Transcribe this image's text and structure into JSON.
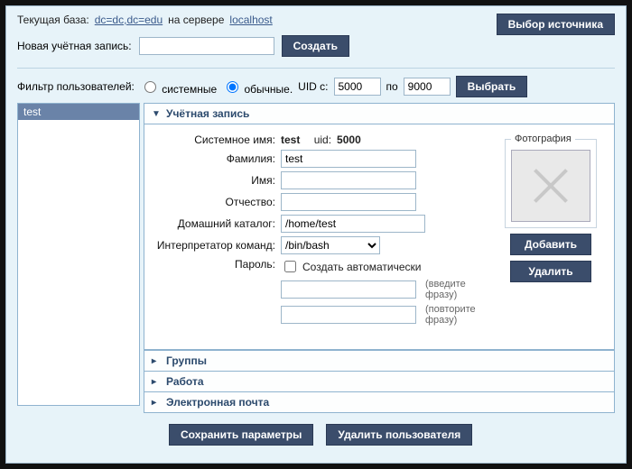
{
  "header": {
    "current_base_label": "Текущая база:",
    "base_value": "dc=dc,dc=edu",
    "on_server_label": "на сервере",
    "server_value": "localhost",
    "source_button": "Выбор источника"
  },
  "new_account": {
    "label": "Новая учётная запись:",
    "value": "",
    "create_button": "Создать"
  },
  "filters": {
    "label": "Фильтр пользователей:",
    "system_label": "системные",
    "regular_label": "обычные.",
    "uid_from_label": "UID с:",
    "uid_from": "5000",
    "uid_to_label": "по",
    "uid_to": "9000",
    "select_button": "Выбрать"
  },
  "user_list": {
    "items": [
      "test"
    ]
  },
  "sections": {
    "account": {
      "title": "Учётная запись",
      "sysname_label": "Системное имя:",
      "sysname_value": "test",
      "uid_label": "uid:",
      "uid_value": "5000",
      "lastname_label": "Фамилия:",
      "lastname_value": "test",
      "firstname_label": "Имя:",
      "firstname_value": "",
      "patronymic_label": "Отчество:",
      "patronymic_value": "",
      "home_label": "Домашний каталог:",
      "home_value": "/home/test",
      "shell_label": "Интерпретатор команд:",
      "shell_value": "/bin/bash",
      "password_label": "Пароль:",
      "auto_password_label": "Создать автоматически",
      "enter_phrase_hint": "(введите фразу)",
      "repeat_phrase_hint": "(повторите фразу)",
      "photo_label": "Фотография",
      "add_button": "Добавить",
      "delete_button": "Удалить"
    },
    "groups_title": "Группы",
    "work_title": "Работа",
    "email_title": "Электронная почта"
  },
  "footer": {
    "save_button": "Сохранить параметры",
    "delete_user_button": "Удалить пользователя"
  }
}
